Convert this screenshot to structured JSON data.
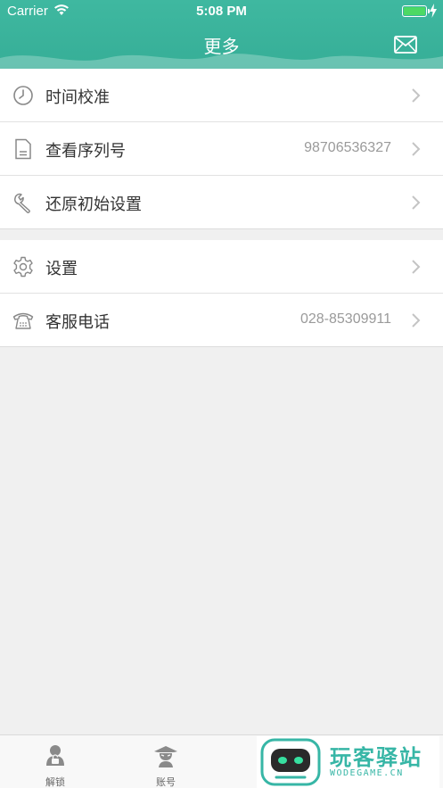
{
  "status_bar": {
    "carrier": "Carrier",
    "time": "5:08 PM"
  },
  "nav": {
    "title": "更多",
    "right_icon": "mail-icon"
  },
  "menu_group_1": [
    {
      "label": "时间校准",
      "value": "",
      "icon": "clock-icon"
    },
    {
      "label": "查看序列号",
      "value": "98706536327",
      "icon": "document-icon"
    },
    {
      "label": "还原初始设置",
      "value": "",
      "icon": "wrench-icon"
    }
  ],
  "menu_group_2": [
    {
      "label": "设置",
      "value": "",
      "icon": "gear-icon"
    },
    {
      "label": "客服电话",
      "value": "028-85309911",
      "icon": "telephone-icon"
    }
  ],
  "tabbar": {
    "tabs": [
      {
        "label": "解锁",
        "icon": "unlock-icon"
      },
      {
        "label": "账号",
        "icon": "account-icon"
      }
    ]
  },
  "watermark": {
    "title": "玩客驿站",
    "subtitle": "WODEGAME.CN"
  },
  "colors": {
    "header": "#3fb8a0",
    "battery": "#4cd964",
    "watermark": "#37b6a6"
  }
}
